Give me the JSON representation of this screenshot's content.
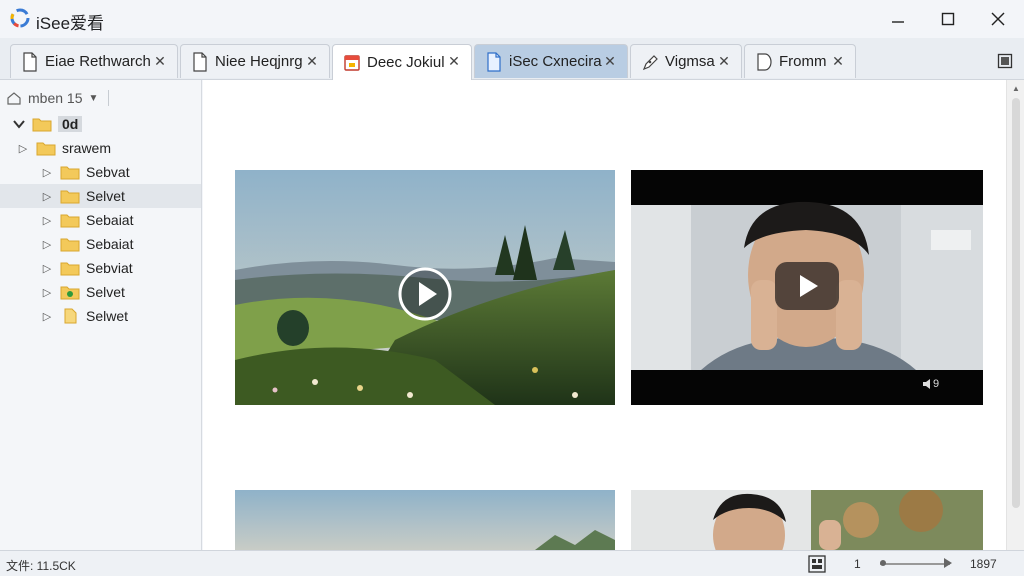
{
  "app": {
    "title": "iSee爱看"
  },
  "tabs": [
    {
      "label": "Eiae Rethwarch",
      "icon": "document-icon"
    },
    {
      "label": "Niee Heqjnrg",
      "icon": "document-icon"
    },
    {
      "label": "Deec Jokiul",
      "icon": "calendar-icon"
    },
    {
      "label": "iSec Cxnecira",
      "icon": "document-icon"
    },
    {
      "label": "Vigmsa",
      "icon": "pen-icon"
    },
    {
      "label": "Fromm",
      "icon": "document-icon"
    }
  ],
  "sidebar": {
    "header": "mben 15",
    "root": "0d",
    "items": [
      {
        "label": "srawem"
      },
      {
        "label": "Sebvat"
      },
      {
        "label": "Selvet"
      },
      {
        "label": "Sebaiat"
      },
      {
        "label": "Sebaiat"
      },
      {
        "label": "Sebviat"
      },
      {
        "label": "Selvet"
      },
      {
        "label": "Selwet"
      }
    ]
  },
  "player": {
    "volume_label": "9"
  },
  "status": {
    "left": "文件: 11.5CK",
    "zoom": "1",
    "right": "1897"
  },
  "colors": {
    "highlight_tab": "#b9cde3",
    "folder": "#f3c95a",
    "folder_edge": "#d9a72e"
  }
}
